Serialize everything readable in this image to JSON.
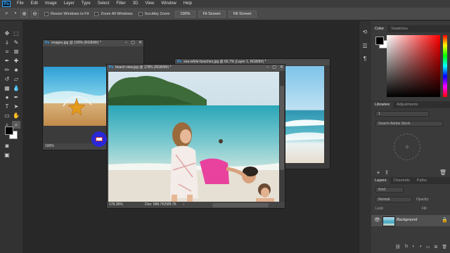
{
  "menu": {
    "logo": "Ps",
    "items": [
      "File",
      "Edit",
      "Image",
      "Layer",
      "Type",
      "Select",
      "Filter",
      "3D",
      "View",
      "Window",
      "Help"
    ]
  },
  "options": {
    "zoom_tool_icon": "magnifier-icon",
    "resize_windows": "Resize Windows to Fit",
    "zoom_all_windows": "Zoom All Windows",
    "scrubby_zoom": "Scrubby Zoom",
    "btn_100": "100%",
    "btn_fit": "Fit Screen",
    "btn_fill": "Fill Screen"
  },
  "docs": {
    "seashell": {
      "title": "images.jpg @ 100% (RGB/8#) *",
      "zoom": "100%"
    },
    "beach_view": {
      "title": "beach view.jpg @ 178% (RGB/8#) *",
      "zoom": "178.36%",
      "doc": "Doc: 589.7K/589.7K"
    },
    "waves": {
      "title": "sea-white-beaches.jpg @ 66.7% (Layer 1, RGB/8#) *"
    }
  },
  "color_panel": {
    "tab_color": "Color",
    "tab_swatches": "Swatches"
  },
  "libraries_panel": {
    "tab_libraries": "Libraries",
    "tab_adjustments": "Adjustments",
    "library": "1",
    "search_placeholder": "Search Adobe Stock"
  },
  "layers_panel": {
    "tab_layers": "Layers",
    "tab_channels": "Channels",
    "tab_paths": "Paths",
    "kind": "Kind",
    "blend_mode": "Normal",
    "opacity_label": "Opacity:",
    "lock_label": "Lock:",
    "fill_label": "Fill:",
    "layer_name": "Background"
  },
  "colors": {
    "foreground": "#000000",
    "background": "#ffffff",
    "accent": "#31a8ff",
    "cursor": "#2a27d8"
  }
}
